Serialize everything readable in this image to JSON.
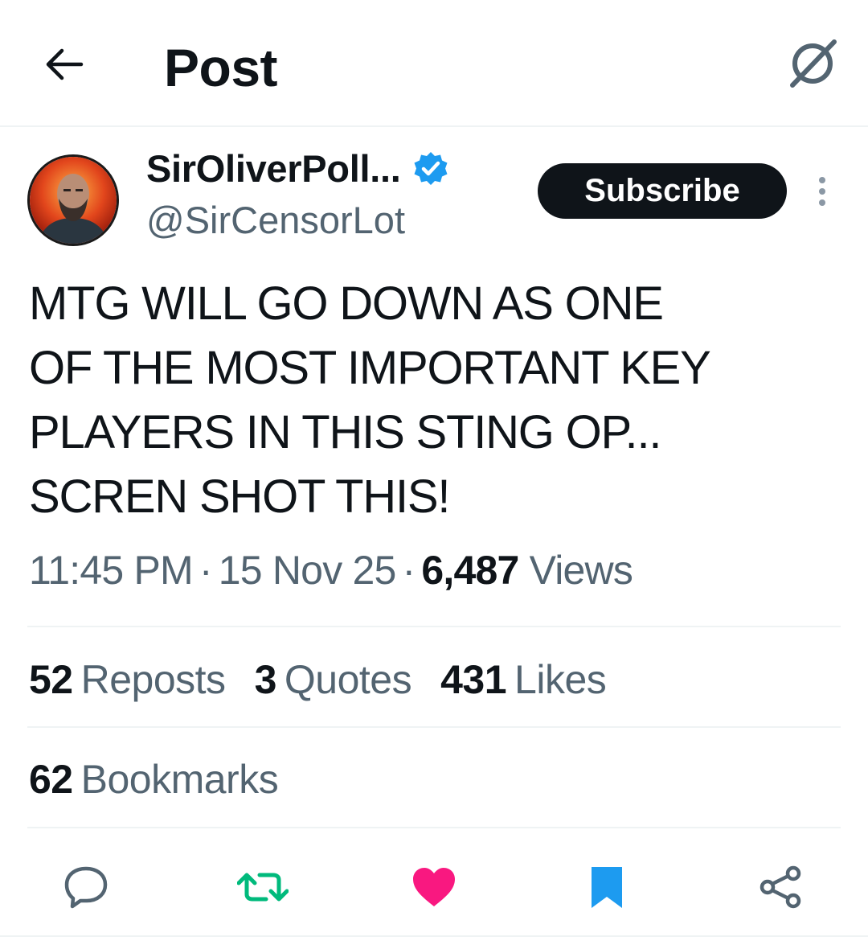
{
  "header": {
    "title": "Post",
    "back_icon": "arrow-left-icon",
    "grok_icon": "grok-icon"
  },
  "author": {
    "display_name": "SirOliverPoll...",
    "handle": "@SirCensorLot",
    "verified": true,
    "subscribe_label": "Subscribe"
  },
  "post": {
    "text": "MTG WILL GO DOWN AS ONE\nOF THE MOST IMPORTANT KEY\nPLAYERS IN THIS STING OP...\nSCREN SHOT THIS!",
    "time": "11:45 PM",
    "date": "15 Nov 25",
    "views_count": "6,487",
    "views_label": "Views"
  },
  "stats": {
    "reposts_count": "52",
    "reposts_label": "Reposts",
    "quotes_count": "3",
    "quotes_label": "Quotes",
    "likes_count": "431",
    "likes_label": "Likes",
    "bookmarks_count": "62",
    "bookmarks_label": "Bookmarks"
  },
  "actions": {
    "reply_icon": "reply-icon",
    "repost_icon": "repost-icon",
    "like_icon": "heart-icon",
    "bookmark_icon": "bookmark-icon",
    "share_icon": "share-icon"
  },
  "colors": {
    "text": "#0f1419",
    "secondary": "#536471",
    "verified": "#1d9bf0",
    "repost_active": "#00ba7c",
    "like_active": "#f91880",
    "bookmark_active": "#1d9bf0",
    "divider": "#eff3f4"
  }
}
